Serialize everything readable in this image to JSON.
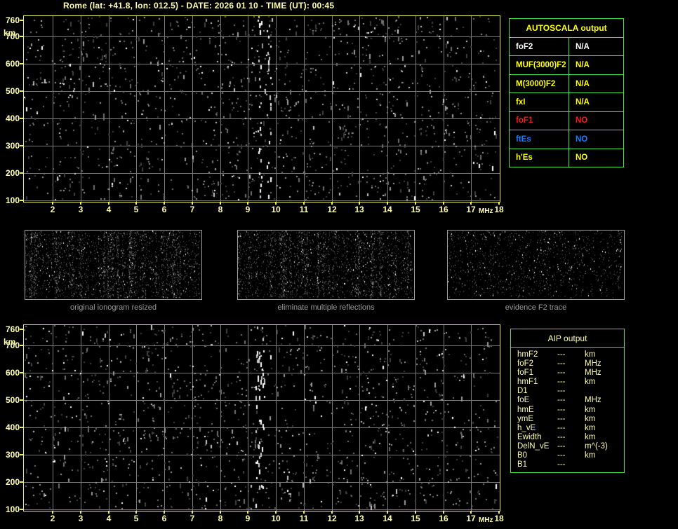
{
  "title": "Rome (lat: +41.8, lon: 012.5) - DATE: 2026 01 10 - TIME (UT): 00:45",
  "colors": {
    "plot_border": "#f0f055",
    "axis_text": "#ffffaa",
    "grid": "#7a7a7a",
    "table_border": "#50e050",
    "header_yellow": "#ffff00",
    "value_white": "#ffffff",
    "value_yellow": "#ffff00",
    "value_red": "#ff1a1a",
    "value_blue": "#1080ff",
    "aip_text": "#ffffaa",
    "caption_gray": "#9a9a9a"
  },
  "chart_data": [
    {
      "type": "scatter",
      "name": "top-ionogram",
      "xlabel": "MHz",
      "ylabel": "km",
      "x_ticks": [
        2,
        3,
        4,
        5,
        6,
        7,
        8,
        9,
        10,
        11,
        12,
        13,
        14,
        15,
        16,
        17,
        18
      ],
      "y_ticks": [
        760,
        700,
        600,
        500,
        400,
        300,
        200,
        100
      ],
      "xlim": [
        1,
        18.1
      ],
      "ylim": [
        85,
        775
      ],
      "grid": true,
      "series": [],
      "content": "random background speckle noise only; no echo traces identified"
    },
    {
      "type": "scatter",
      "name": "bottom-ionogram",
      "xlabel": "MHz",
      "ylabel": "km",
      "x_ticks": [
        2,
        3,
        4,
        5,
        6,
        7,
        8,
        9,
        10,
        11,
        12,
        13,
        14,
        15,
        16,
        17,
        18
      ],
      "y_ticks": [
        760,
        700,
        600,
        500,
        400,
        300,
        200,
        100
      ],
      "xlim": [
        1,
        18.1
      ],
      "ylim": [
        85,
        775
      ],
      "grid": true,
      "series": [],
      "content": "random background speckle noise only; no echo traces identified"
    }
  ],
  "autoscala_table": {
    "title": "AUTOSCALA output",
    "rows": [
      {
        "label": "foF2",
        "value": "N/A",
        "color": "#ffffff"
      },
      {
        "label": "MUF(3000)F2",
        "value": "N/A",
        "color": "#ffff00"
      },
      {
        "label": "M(3000)F2",
        "value": "N/A",
        "color": "#ffff00"
      },
      {
        "label": "fxI",
        "value": "N/A",
        "color": "#ffff00"
      },
      {
        "label": "foF1",
        "value": "NO",
        "color": "#ff1a1a"
      },
      {
        "label": "ftEs",
        "value": "NO",
        "color": "#1080ff"
      },
      {
        "label": "h'Es",
        "value": "NO",
        "color": "#ffff00"
      }
    ]
  },
  "aip_table": {
    "title": "AIP output",
    "rows": [
      {
        "param": "hmF2",
        "value": "---",
        "unit": "km"
      },
      {
        "param": "foF2",
        "value": "---",
        "unit": "MHz"
      },
      {
        "param": "foF1",
        "value": "---",
        "unit": "MHz"
      },
      {
        "param": "hmF1",
        "value": "---",
        "unit": "km"
      },
      {
        "param": "D1",
        "value": "---",
        "unit": ""
      },
      {
        "param": "foE",
        "value": "---",
        "unit": "MHz"
      },
      {
        "param": "hmE",
        "value": "---",
        "unit": "km"
      },
      {
        "param": "ymE",
        "value": "---",
        "unit": "km"
      },
      {
        "param": "h_vE",
        "value": "---",
        "unit": "km"
      },
      {
        "param": "Ewidth",
        "value": "---",
        "unit": "km"
      },
      {
        "param": "DelN_vE",
        "value": "---",
        "unit": "m^(-3)"
      },
      {
        "param": "B0",
        "value": "---",
        "unit": "km"
      },
      {
        "param": "B1",
        "value": "---",
        "unit": ""
      }
    ]
  },
  "thumbnails": [
    {
      "caption": "original ionogram resized"
    },
    {
      "caption": "eliminate multiple reflections"
    },
    {
      "caption": "evidence F2 trace"
    }
  ]
}
